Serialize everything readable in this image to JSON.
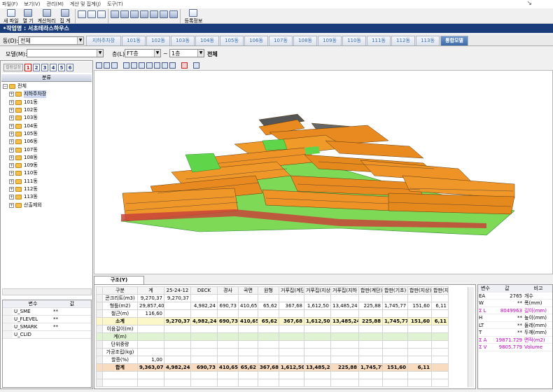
{
  "menu": [
    "파일(F)",
    "보기(V)",
    "관리(M)",
    "계산 및 집계(J)",
    "도구(T)"
  ],
  "toolbar": {
    "buttons": [
      {
        "label": "새 파일"
      },
      {
        "label": "열 기"
      },
      {
        "label": "계산처리"
      },
      {
        "label": "집 계"
      }
    ],
    "register_label": "등록정보"
  },
  "project_title": "•작업명 : 서초테라스하우스",
  "building_label": "동(D):",
  "building_value": "전체",
  "tabs": [
    "지하주차장",
    "101동",
    "102동",
    "103동",
    "104동",
    "105동",
    "106동",
    "107동",
    "108동",
    "109동",
    "110동",
    "111동",
    "112동",
    "113동",
    "통합모델"
  ],
  "active_tab": "통합모델",
  "filter": {
    "model_label": "모델(M):",
    "model_value": "",
    "floor_label": "층(L):",
    "floor_from": "FT층",
    "tilde": "~",
    "floor_to": "1층",
    "all_label": "전체"
  },
  "left_toolbar": {
    "colset_label": "컬럼설정",
    "numbers": [
      "1",
      "2",
      "3",
      "4",
      "5",
      "6"
    ]
  },
  "class_header": "분류",
  "tree": [
    {
      "label": "전체",
      "level": 0
    },
    {
      "label": "지하주차장",
      "level": 1,
      "selected": true
    },
    {
      "label": "101동",
      "level": 1
    },
    {
      "label": "102동",
      "level": 1
    },
    {
      "label": "103동",
      "level": 1
    },
    {
      "label": "104동",
      "level": 1
    },
    {
      "label": "105동",
      "level": 1
    },
    {
      "label": "106동",
      "level": 1
    },
    {
      "label": "107동",
      "level": 1
    },
    {
      "label": "108동",
      "level": 1
    },
    {
      "label": "109동",
      "level": 1
    },
    {
      "label": "110동",
      "level": 1
    },
    {
      "label": "111동",
      "level": 1
    },
    {
      "label": "112동",
      "level": 1
    },
    {
      "label": "113동",
      "level": 1
    },
    {
      "label": "산출제외",
      "level": 1
    }
  ],
  "var_grid": {
    "headers": [
      "변수",
      "값"
    ],
    "rows": [
      [
        "U_SME",
        "**"
      ],
      [
        "U_FLEVEL",
        "**"
      ],
      [
        "U_SMARK",
        "**"
      ],
      [
        "U_CLID",
        ""
      ]
    ]
  },
  "bottom_tab": "구조(Y)",
  "table": {
    "headers": [
      "구분",
      "계",
      "25-24-12",
      "DECK",
      "경사",
      "곡면",
      "원형",
      "거푸집(계단",
      "거푸집(지상",
      "거푸집(지하",
      "합판(계단)",
      "합판(기초)",
      "합판(지상)",
      "합판(지"
    ],
    "rows": [
      {
        "type": "normal",
        "cells": [
          "콘크리트(m3)",
          "9,270,37",
          "9,270,37",
          "",
          "",
          "",
          "",
          "",
          "",
          "",
          "",
          "",
          "",
          ""
        ]
      },
      {
        "type": "normal",
        "cells": [
          "형틀(m2)",
          "29,857,40",
          "",
          "4,982,24",
          "690,73",
          "410,65",
          "65,62",
          "367,68",
          "1,612,50",
          "13,485,24",
          "225,88",
          "1,745,77",
          "151,60",
          "6,11"
        ]
      },
      {
        "type": "normal",
        "cells": [
          "철근(m)",
          "116,60",
          "",
          "",
          "",
          "",
          "",
          "",
          "",
          "",
          "",
          "",
          "",
          ""
        ]
      },
      {
        "type": "subtotal",
        "cells": [
          "소계",
          "",
          "9,270,37",
          "4,982,24",
          "690,73",
          "410,65",
          "65,62",
          "367,68",
          "1,612,50",
          "13,485,24",
          "225,88",
          "1,745,77",
          "151,60",
          "6,11"
        ]
      },
      {
        "type": "normal",
        "cells": [
          "이음길이(m)",
          "",
          "",
          "",
          "",
          "",
          "",
          "",
          "",
          "",
          "",
          "",
          "",
          ""
        ]
      },
      {
        "type": "green",
        "cells": [
          "계(m)",
          "",
          "",
          "",
          "",
          "",
          "",
          "",
          "",
          "",
          "",
          "",
          "",
          ""
        ]
      },
      {
        "type": "normal",
        "cells": [
          "단위중량",
          "",
          "",
          "",
          "",
          "",
          "",
          "",
          "",
          "",
          "",
          "",
          "",
          ""
        ]
      },
      {
        "type": "normal",
        "cells": [
          "가공조립(kg)",
          "",
          "",
          "",
          "",
          "",
          "",
          "",
          "",
          "",
          "",
          "",
          "",
          ""
        ]
      },
      {
        "type": "normal",
        "cells": [
          "할증(%)",
          "1,00",
          "",
          "",
          "",
          "",
          "",
          "",
          "",
          "",
          "",
          "",
          "",
          ""
        ]
      },
      {
        "type": "total",
        "cells": [
          "합계",
          "9,363,07",
          "4,982,24",
          "690,73",
          "410,65",
          "65,62",
          "367,68",
          "1,612,50",
          "13,485,24",
          "225,88",
          "1,745,77",
          "151,60",
          "6,11",
          ""
        ]
      }
    ]
  },
  "right_grid": {
    "headers": [
      "변수",
      "값",
      "비고"
    ],
    "rows": [
      {
        "c1": "EA",
        "c2": "2765",
        "c3": "개수",
        "pink": false
      },
      {
        "c1": "W",
        "c2": "**",
        "c3": "폭(mm)",
        "pink": false
      },
      {
        "c1": "Σ L",
        "c2": "8049963",
        "c3": "길이(mm)",
        "pink": true
      },
      {
        "c1": "H",
        "c2": "**",
        "c3": "높이(mm)",
        "pink": false
      },
      {
        "c1": "LT",
        "c2": "**",
        "c3": "둘레(mm)",
        "pink": false
      },
      {
        "c1": "T",
        "c2": "**",
        "c3": "두께(mm)",
        "pink": false
      },
      {
        "c1": "Σ A",
        "c2": "19871.729",
        "c3": "면적(m2)",
        "pink": true
      },
      {
        "c1": "Σ V",
        "c2": "9805.779",
        "c3": "Volume",
        "pink": true
      }
    ]
  }
}
